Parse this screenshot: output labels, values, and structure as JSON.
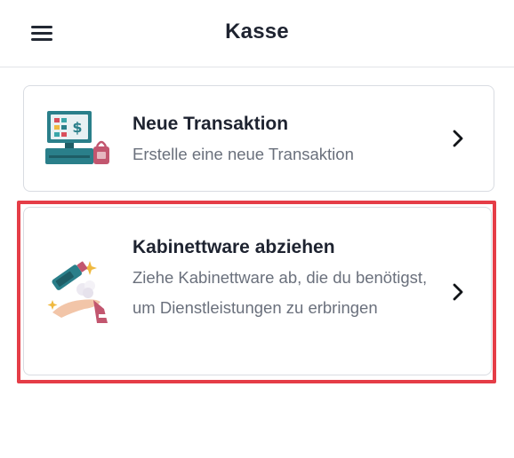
{
  "header": {
    "title": "Kasse",
    "menu_icon": "hamburger-menu-icon"
  },
  "cards": [
    {
      "title": "Neue Transaktion",
      "description": "Erstelle eine neue Transaktion",
      "icon": "cash-register-icon",
      "chevron_icon": "chevron-right-icon"
    },
    {
      "title": "Kabinettware abziehen",
      "description": "Ziehe Kabinettware ab, die du benötigst, um Dienstleistungen zu erbringen",
      "icon": "product-in-hand-icon",
      "chevron_icon": "chevron-right-icon",
      "highlighted": true
    }
  ],
  "colors": {
    "highlight": "#e53d47",
    "teal": "#2a7f8a",
    "text_primary": "#1e2330",
    "text_secondary": "#6a707c",
    "accent_pink": "#c2566f"
  }
}
